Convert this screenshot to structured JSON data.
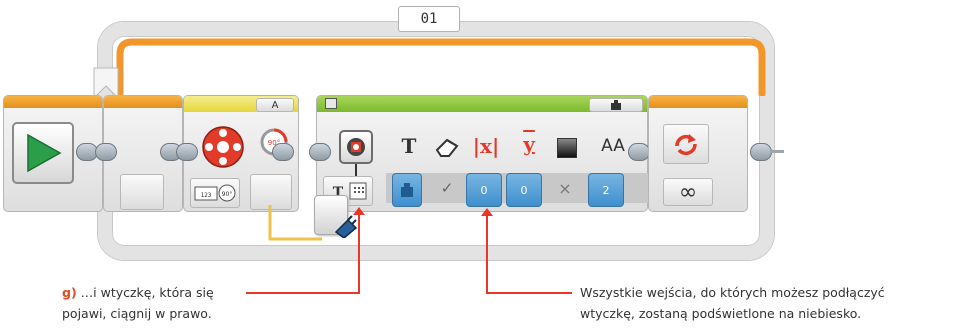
{
  "loop": {
    "label": "01",
    "mode": "∞"
  },
  "blocks": {
    "display_mode_tab": "A"
  },
  "display_params": [
    {
      "icon": "T",
      "kind": "text",
      "value": ""
    },
    {
      "icon": "eraser-icon",
      "kind": "clear",
      "value": "✓"
    },
    {
      "icon": "|x|",
      "kind": "x",
      "value": "0"
    },
    {
      "icon": "y",
      "kind": "y",
      "value": "0"
    },
    {
      "icon": "color-square-icon",
      "kind": "color",
      "value": "×"
    },
    {
      "icon": "AA",
      "kind": "font",
      "value": "2"
    }
  ],
  "captions": {
    "left_step": "g)",
    "left_line1": " …i wtyczkę, która się",
    "left_line2": "pojawi, ciągnij w prawo.",
    "right_line1": "Wszystkie wejścia, do których możesz podłączyć",
    "right_line2": "wtyczkę, zostaną podświetlone na niebiesko."
  },
  "colors": {
    "loop_orange": "#f0962a",
    "start_green": "#2a9e4a",
    "highlight_blue": "#4a99d6",
    "annotation_red": "#e8372a",
    "yellow_wire": "#efc14a"
  }
}
